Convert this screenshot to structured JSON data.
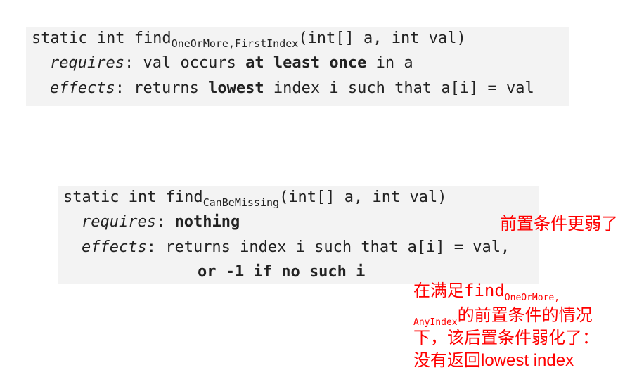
{
  "spec1": {
    "sig_prefix": "static int find",
    "sig_sub": "OneOrMore,FirstIndex",
    "sig_suffix": "(int[] a, int val)",
    "req_label": "requires",
    "req_colon": ": val occurs ",
    "req_bold": "at least once",
    "req_tail": " in a",
    "eff_label": "effects",
    "eff_colon": ":  returns ",
    "eff_bold": "lowest",
    "eff_tail": " index i such that a[i] = val"
  },
  "spec2": {
    "sig_prefix": "static int find",
    "sig_sub": "CanBeMissing",
    "sig_suffix": "(int[] a, int val)",
    "req_label": "requires",
    "req_colon": ": ",
    "req_bold": "nothing",
    "eff_label": "effects",
    "eff_colon": ":  returns index i such that a[i] = val,",
    "eff_line2": "or -1 if no such i"
  },
  "notes": {
    "weaker_pre": "前置条件更弱了",
    "n_line1_prefix": "在满足",
    "n_line1_find": "find",
    "n_line1_sub": "OneOrMore,",
    "n_line2_sub": "AnyIndex",
    "n_line2_tail": "的前置条件的情况",
    "n_line3": "下，该后置条件弱化了：",
    "n_line4_prefix": "没有返回",
    "n_line4_tail": "lowest index"
  },
  "colors": {
    "annotation": "#ff0000",
    "code_bg": "#f3f3f3"
  }
}
